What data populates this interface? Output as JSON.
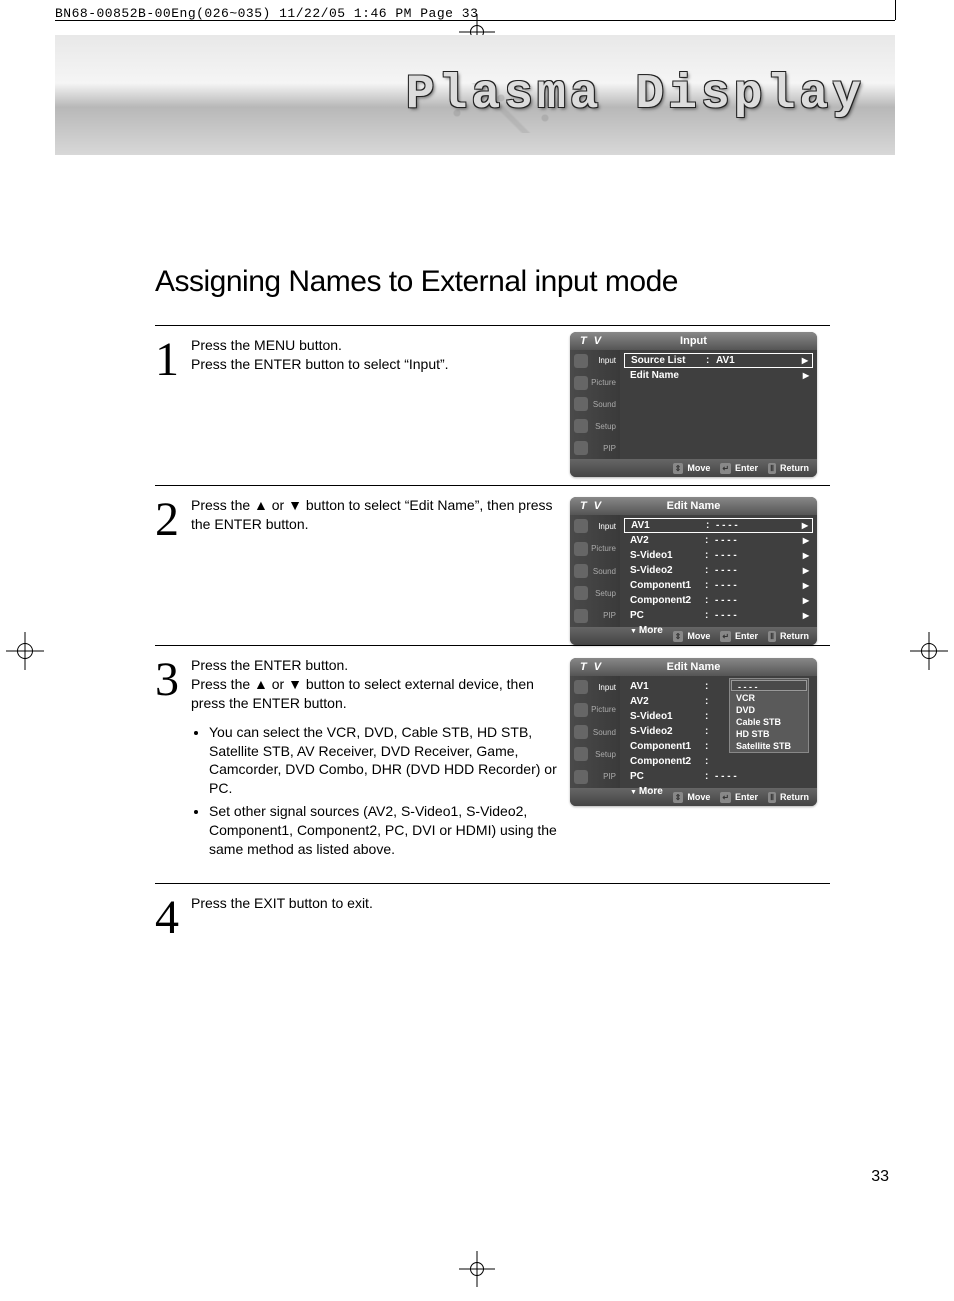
{
  "crop_header": "BN68-00852B-00Eng(026~035)  11/22/05  1:46 PM  Page 33",
  "banner_title": "Plasma Display",
  "page_title": "Assigning Names to External input mode",
  "steps": [
    {
      "num": "1",
      "lines": [
        "Press the MENU button.",
        "Press the ENTER button to select “Input”."
      ]
    },
    {
      "num": "2",
      "lines": [
        "Press the ▲ or ▼ button to select “Edit Name”, then press the ENTER button."
      ]
    },
    {
      "num": "3",
      "lines": [
        "Press the ENTER button.",
        "Press the ▲ or ▼ button to select external device, then press the ENTER button."
      ],
      "bullets": [
        "You can select the VCR, DVD, Cable STB, HD STB, Satellite STB, AV Receiver, DVD Receiver, Game, Camcorder, DVD Combo, DHR (DVD HDD Recorder) or PC.",
        "Set other signal sources (AV2, S-Video1, S-Video2, Component1, Component2, PC, DVI or HDMI) using the same method as listed above."
      ]
    },
    {
      "num": "4",
      "lines": [
        "Press the EXIT button to exit."
      ]
    }
  ],
  "sidebar": [
    "Input",
    "Picture",
    "Sound",
    "Setup",
    "PIP"
  ],
  "osd_tv": "T V",
  "osd1": {
    "title": "Input",
    "rows": [
      {
        "label": "Source List",
        "val": "AV1",
        "sel": true,
        "arrow": true
      },
      {
        "label": "Edit Name",
        "val": "",
        "sel": false,
        "arrow": true
      }
    ]
  },
  "osd2": {
    "title": "Edit Name",
    "rows": [
      {
        "label": "AV1",
        "val": "- - - -",
        "sel": true,
        "arrow": true
      },
      {
        "label": "AV2",
        "val": "- - - -",
        "arrow": true
      },
      {
        "label": "S-Video1",
        "val": "- - - -",
        "arrow": true
      },
      {
        "label": "S-Video2",
        "val": "- - - -",
        "arrow": true
      },
      {
        "label": "Component1",
        "val": "- - - -",
        "arrow": true
      },
      {
        "label": "Component2",
        "val": "- - - -",
        "arrow": true
      },
      {
        "label": "PC",
        "val": "- - - -",
        "arrow": true
      },
      {
        "label": "More",
        "more": true
      }
    ]
  },
  "osd3": {
    "title": "Edit Name",
    "rows": [
      {
        "label": "AV1",
        "val": ""
      },
      {
        "label": "AV2",
        "val": ""
      },
      {
        "label": "S-Video1",
        "val": ""
      },
      {
        "label": "S-Video2",
        "val": ""
      },
      {
        "label": "Component1",
        "val": ""
      },
      {
        "label": "Component2",
        "val": ""
      },
      {
        "label": "PC",
        "val": "- - - -"
      },
      {
        "label": "More",
        "more": true
      }
    ],
    "dropdown": [
      "- - - -",
      "VCR",
      "DVD",
      "Cable STB",
      "HD STB",
      "Satellite STB"
    ]
  },
  "footer": {
    "move": "Move",
    "enter": "Enter",
    "return": "Return"
  },
  "page_num": "33"
}
